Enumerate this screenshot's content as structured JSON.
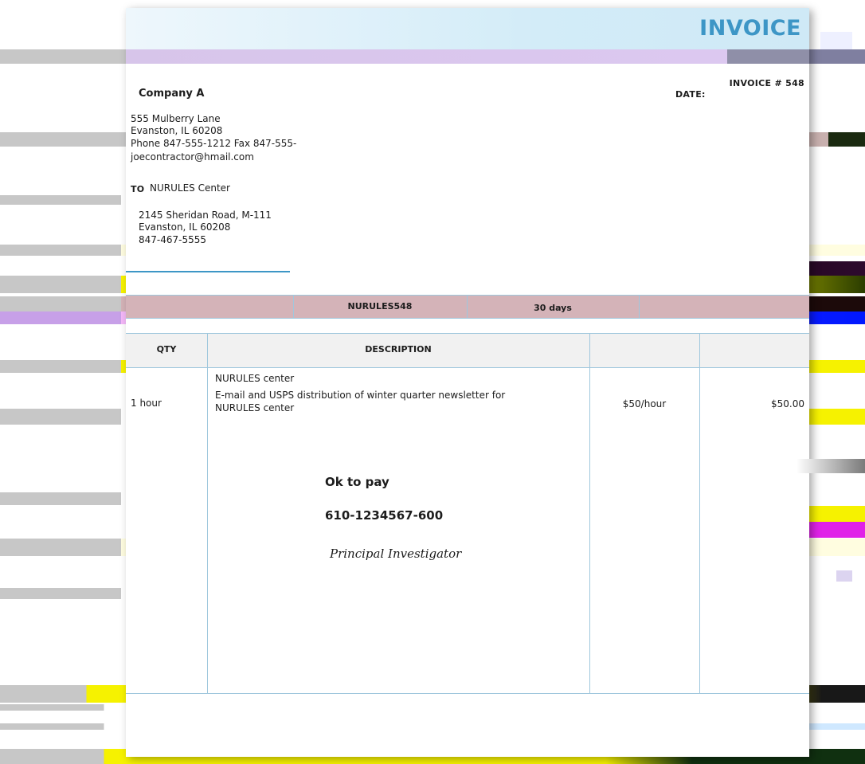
{
  "invoice": {
    "title": "INVOICE",
    "number_label": "INVOICE # 548",
    "date_label": "DATE:"
  },
  "from": {
    "company": "Company A",
    "address_1": "555 Mulberry Lane",
    "address_2": "Evanston, IL 60208",
    "phone_fax": "Phone 847-555-1212 Fax 847-555-",
    "email": "joecontractor@hmail.com"
  },
  "to": {
    "label": "TO",
    "name": "NURULES Center",
    "address_1": "2145 Sheridan Road, M-111",
    "address_2": "Evanston, IL 60208",
    "phone": "847-467-5555"
  },
  "order_row": {
    "reference": "NURULES548",
    "terms": "30 days"
  },
  "table": {
    "col_qty": "QTY",
    "col_description": "DESCRIPTION",
    "items": [
      {
        "qty": "",
        "description": "NURULES center",
        "unit_price": "",
        "line_total": ""
      },
      {
        "qty": "1 hour",
        "description": "E-mail and USPS distribution of winter quarter newsletter for",
        "description_2": "NURULES center",
        "unit_price": "$50/hour",
        "line_total": "$50.00"
      }
    ]
  },
  "approval": {
    "ok_to_pay": "Ok to pay",
    "account": "610-1234567-600",
    "signature": "Principal Investigator"
  },
  "colors": {
    "accent": "#3d96c6",
    "glitch_yellow": "#f6f200",
    "glitch_magenta": "#e021e8"
  }
}
